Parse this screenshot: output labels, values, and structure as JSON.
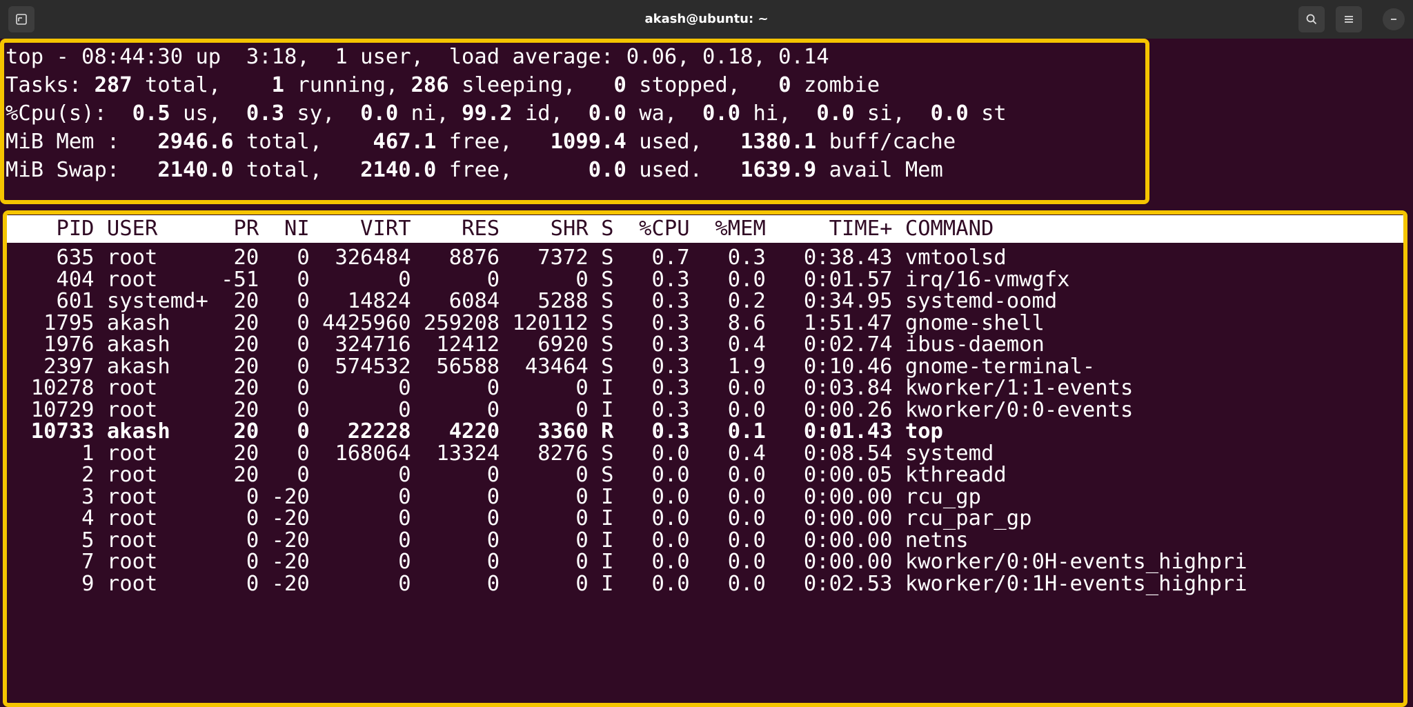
{
  "window": {
    "title": "akash@ubuntu: ~"
  },
  "summary": {
    "uptime_line": "top - 08:44:30 up  3:18,  1 user,  load average: 0.06, 0.18, 0.14",
    "tasks": {
      "label": "Tasks:",
      "total": "287",
      "running": "1",
      "sleeping": "286",
      "stopped": "0",
      "zombie": "0"
    },
    "cpu": {
      "label": "%Cpu(s):",
      "us": "0.5",
      "sy": "0.3",
      "ni": "0.0",
      "id": "99.2",
      "wa": "0.0",
      "hi": "0.0",
      "si": "0.0",
      "st": "0.0"
    },
    "mem": {
      "label": "MiB Mem :",
      "total": "2946.6",
      "free": "467.1",
      "used": "1099.4",
      "buff_cache": "1380.1"
    },
    "swap": {
      "label": "MiB Swap:",
      "total": "2140.0",
      "free": "2140.0",
      "used": "0.0",
      "avail_mem": "1639.9"
    }
  },
  "table": {
    "headers": [
      "PID",
      "USER",
      "PR",
      "NI",
      "VIRT",
      "RES",
      "SHR",
      "S",
      "%CPU",
      "%MEM",
      "TIME+",
      "COMMAND"
    ],
    "rows": [
      [
        "635",
        "root",
        "20",
        "0",
        "326484",
        "8876",
        "7372",
        "S",
        "0.7",
        "0.3",
        "0:38.43",
        "vmtoolsd"
      ],
      [
        "404",
        "root",
        "-51",
        "0",
        "0",
        "0",
        "0",
        "S",
        "0.3",
        "0.0",
        "0:01.57",
        "irq/16-vmwgfx"
      ],
      [
        "601",
        "systemd+",
        "20",
        "0",
        "14824",
        "6084",
        "5288",
        "S",
        "0.3",
        "0.2",
        "0:34.95",
        "systemd-oomd"
      ],
      [
        "1795",
        "akash",
        "20",
        "0",
        "4425960",
        "259208",
        "120112",
        "S",
        "0.3",
        "8.6",
        "1:51.47",
        "gnome-shell"
      ],
      [
        "1976",
        "akash",
        "20",
        "0",
        "324716",
        "12412",
        "6920",
        "S",
        "0.3",
        "0.4",
        "0:02.74",
        "ibus-daemon"
      ],
      [
        "2397",
        "akash",
        "20",
        "0",
        "574532",
        "56588",
        "43464",
        "S",
        "0.3",
        "1.9",
        "0:10.46",
        "gnome-terminal-"
      ],
      [
        "10278",
        "root",
        "20",
        "0",
        "0",
        "0",
        "0",
        "I",
        "0.3",
        "0.0",
        "0:03.84",
        "kworker/1:1-events"
      ],
      [
        "10729",
        "root",
        "20",
        "0",
        "0",
        "0",
        "0",
        "I",
        "0.3",
        "0.0",
        "0:00.26",
        "kworker/0:0-events"
      ],
      [
        "10733",
        "akash",
        "20",
        "0",
        "22228",
        "4220",
        "3360",
        "R",
        "0.3",
        "0.1",
        "0:01.43",
        "top"
      ],
      [
        "1",
        "root",
        "20",
        "0",
        "168064",
        "13324",
        "8276",
        "S",
        "0.0",
        "0.4",
        "0:08.54",
        "systemd"
      ],
      [
        "2",
        "root",
        "20",
        "0",
        "0",
        "0",
        "0",
        "S",
        "0.0",
        "0.0",
        "0:00.05",
        "kthreadd"
      ],
      [
        "3",
        "root",
        "0",
        "-20",
        "0",
        "0",
        "0",
        "I",
        "0.0",
        "0.0",
        "0:00.00",
        "rcu_gp"
      ],
      [
        "4",
        "root",
        "0",
        "-20",
        "0",
        "0",
        "0",
        "I",
        "0.0",
        "0.0",
        "0:00.00",
        "rcu_par_gp"
      ],
      [
        "5",
        "root",
        "0",
        "-20",
        "0",
        "0",
        "0",
        "I",
        "0.0",
        "0.0",
        "0:00.00",
        "netns"
      ],
      [
        "7",
        "root",
        "0",
        "-20",
        "0",
        "0",
        "0",
        "I",
        "0.0",
        "0.0",
        "0:00.00",
        "kworker/0:0H-events_highpri"
      ],
      [
        "9",
        "root",
        "0",
        "-20",
        "0",
        "0",
        "0",
        "I",
        "0.0",
        "0.0",
        "0:02.53",
        "kworker/0:1H-events_highpri"
      ]
    ],
    "bold_pid": "10733"
  },
  "colors": {
    "background": "#300a24",
    "highlight_border": "#f5c400",
    "titlebar": "#2c2c2c"
  }
}
